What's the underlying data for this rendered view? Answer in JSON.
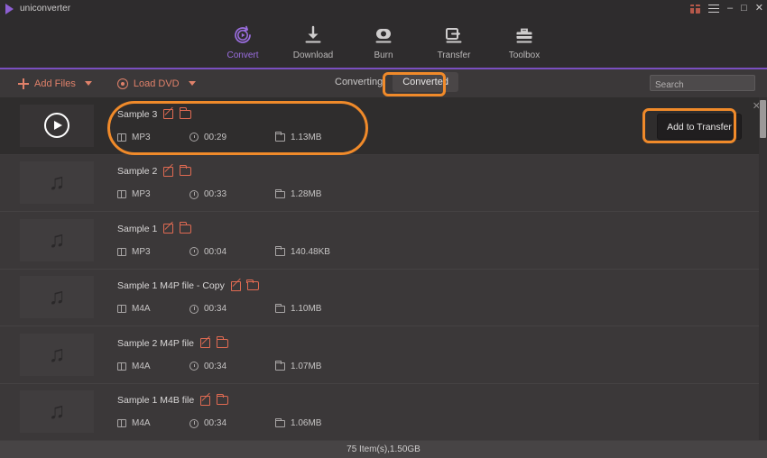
{
  "window": {
    "title": "uniconverter",
    "logo_icon": "play-triangle-icon",
    "controls": {
      "gift": "gift-icon",
      "menu": "hamburger-menu-icon",
      "minimize": "–",
      "maximize": "□",
      "close": "✕"
    }
  },
  "nav": {
    "items": [
      {
        "label": "Convert",
        "icon": "convert-icon",
        "active": true
      },
      {
        "label": "Download",
        "icon": "download-icon",
        "active": false
      },
      {
        "label": "Burn",
        "icon": "burn-icon",
        "active": false
      },
      {
        "label": "Transfer",
        "icon": "transfer-icon",
        "active": false
      },
      {
        "label": "Toolbox",
        "icon": "toolbox-icon",
        "active": false
      }
    ],
    "accent_color": "#7a4fc0"
  },
  "toolbar": {
    "add_files_label": "Add Files",
    "load_dvd_label": "Load DVD",
    "accent_color": "#e0816a",
    "tabs": [
      {
        "label": "Converting",
        "active": false
      },
      {
        "label": "Converted",
        "active": true
      }
    ],
    "search": {
      "placeholder": "Search",
      "value": ""
    }
  },
  "list": {
    "transfer_button_label": "Add to Transfer",
    "rows": [
      {
        "name": "Sample 3",
        "format": "MP3",
        "duration": "00:29",
        "size": "1.13MB",
        "thumb": "play-circle-icon",
        "selected": true
      },
      {
        "name": "Sample 2",
        "format": "MP3",
        "duration": "00:33",
        "size": "1.28MB",
        "thumb": "music-note-icon",
        "selected": false
      },
      {
        "name": "Sample 1",
        "format": "MP3",
        "duration": "00:04",
        "size": "140.48KB",
        "thumb": "music-note-icon",
        "selected": false
      },
      {
        "name": "Sample 1 M4P file - Copy",
        "format": "M4A",
        "duration": "00:34",
        "size": "1.10MB",
        "thumb": "music-note-icon",
        "selected": false
      },
      {
        "name": "Sample 2 M4P file",
        "format": "M4A",
        "duration": "00:34",
        "size": "1.07MB",
        "thumb": "music-note-icon",
        "selected": false
      },
      {
        "name": "Sample 1 M4B file",
        "format": "M4A",
        "duration": "00:34",
        "size": "1.06MB",
        "thumb": "music-note-icon",
        "selected": false
      }
    ]
  },
  "statusbar": {
    "text": "75 Item(s),1.50GB"
  },
  "annotations": {
    "color": "#f08a2a",
    "targets": [
      "converted-tab",
      "first-row",
      "add-to-transfer-button"
    ]
  }
}
